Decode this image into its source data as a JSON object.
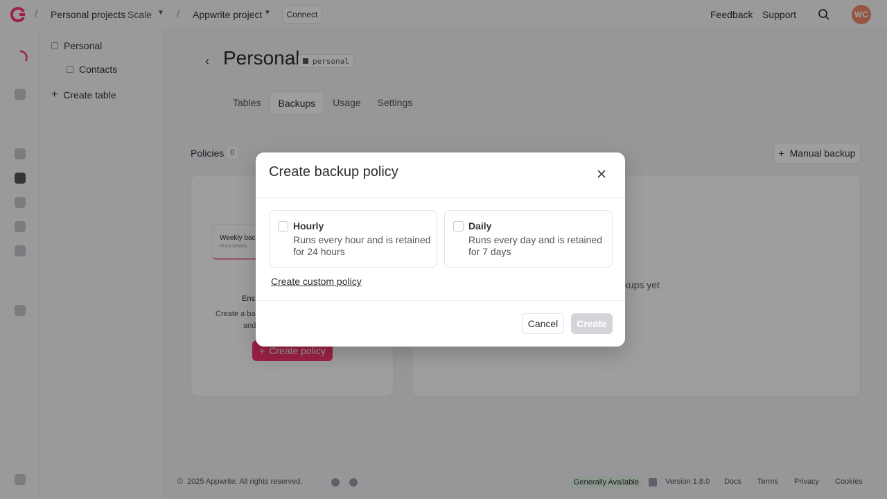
{
  "topbar": {
    "org": "Personal projects",
    "plan": "Scale",
    "project": "Appwrite project",
    "connect_label": "Connect",
    "feedback_label": "Feedback",
    "support_label": "Support",
    "avatar_initials": "WC"
  },
  "sidebar": {
    "database": "Personal",
    "table": "Contacts",
    "create_table": "Create table"
  },
  "page": {
    "title": "Personal",
    "id": "personal",
    "tabs": [
      {
        "label": "Tables"
      },
      {
        "label": "Backups"
      },
      {
        "label": "Usage"
      },
      {
        "label": "Settings"
      }
    ]
  },
  "backups": {
    "policies_label": "Policies",
    "policies_count": "0",
    "manual_backup": "Manual backup",
    "preview_title": "Weekly backup",
    "preview_sub": "Runs weekly",
    "empty_heading": "Ens",
    "empty_desc_1": "Create a ba",
    "empty_desc_2": "and",
    "create_policy": "Create policy",
    "no_backups_tail": "ackups yet"
  },
  "modal": {
    "title": "Create backup policy",
    "options": [
      {
        "title": "Hourly",
        "desc": "Runs every hour and is retained for 24 hours"
      },
      {
        "title": "Daily",
        "desc": "Runs every day and is retained for 7 days"
      }
    ],
    "custom_link": "Create custom policy",
    "cancel_label": "Cancel",
    "create_label": "Create"
  },
  "footer": {
    "copyright": "2025 Appwrite. All rights reserved.",
    "status": "Generally Available",
    "version": "Version 1.8.0",
    "links": [
      "Docs",
      "Terms",
      "Privacy",
      "Cookies"
    ]
  },
  "colors": {
    "brand": "#fd366e",
    "avatar": "#f28c6c",
    "disabled": "#d4d4db"
  }
}
